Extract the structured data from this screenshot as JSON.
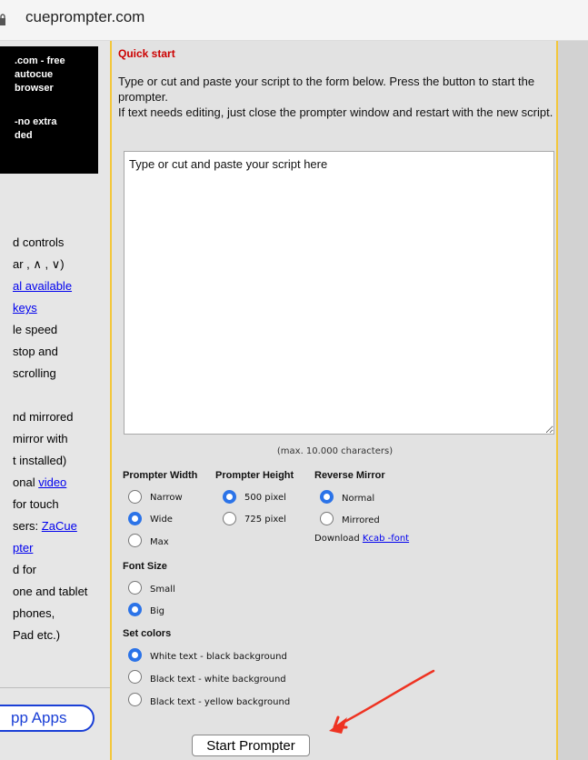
{
  "browser": {
    "url": "cueprompter.com"
  },
  "sidebar": {
    "promo_lines": [
      ".com - free",
      " autocue",
      " browser",
      "",
      "-no extra",
      "ded"
    ],
    "features": {
      "l1": "d controls",
      "l2": "ar , ∧ , ∨)",
      "l3_link": "al available",
      "l4_link": "keys",
      "l5": "le speed",
      "l6": " stop and",
      "l7": "scrolling",
      "l8": "nd mirrored",
      "l9": " mirror with",
      "l10": "t installed)",
      "l11_prefix": "onal ",
      "l11_link": "video",
      "l12": " for touch",
      "l13_prefix": "sers: ",
      "l13_link": "ZaCue",
      "l14_link": "pter",
      "l15": "d for",
      "l16": "one and tablet",
      "l17": " phones,",
      "l18": "Pad etc.)"
    },
    "apps_button": "pp Apps"
  },
  "main": {
    "title": "Quick start",
    "intro_1": "Type or cut and paste your script to the form below. Press the button to start the prompter.",
    "intro_2": "If text needs editing, just close the prompter window and restart with the new script.",
    "script_placeholder": "Type or cut and paste your script here",
    "max_chars": "(max. 10.000 characters)",
    "prompter_width": {
      "label": "Prompter Width",
      "options": [
        "Narrow",
        "Wide",
        "Max"
      ],
      "selected": "Wide"
    },
    "prompter_height": {
      "label": "Prompter Height",
      "options": [
        "500 pixel",
        "725 pixel"
      ],
      "selected": "500 pixel"
    },
    "reverse_mirror": {
      "label": "Reverse Mirror",
      "options": [
        "Normal",
        "Mirrored"
      ],
      "selected": "Normal",
      "download_prefix": "Download ",
      "download_link": "Kcab -font"
    },
    "font_size": {
      "label": "Font Size",
      "options": [
        "Small",
        "Big"
      ],
      "selected": "Big"
    },
    "colors": {
      "label": "Set colors",
      "options": [
        "White text - black background",
        "Black text - white background",
        "Black text - yellow background"
      ],
      "selected": "White text - black background"
    },
    "start_button": "Start Prompter"
  },
  "accent_colors": {
    "radio_selected": "#2b73e8",
    "title_red": "#cc0000",
    "border_yellow": "#f3c73a",
    "annotation_arrow": "#ee3322"
  }
}
